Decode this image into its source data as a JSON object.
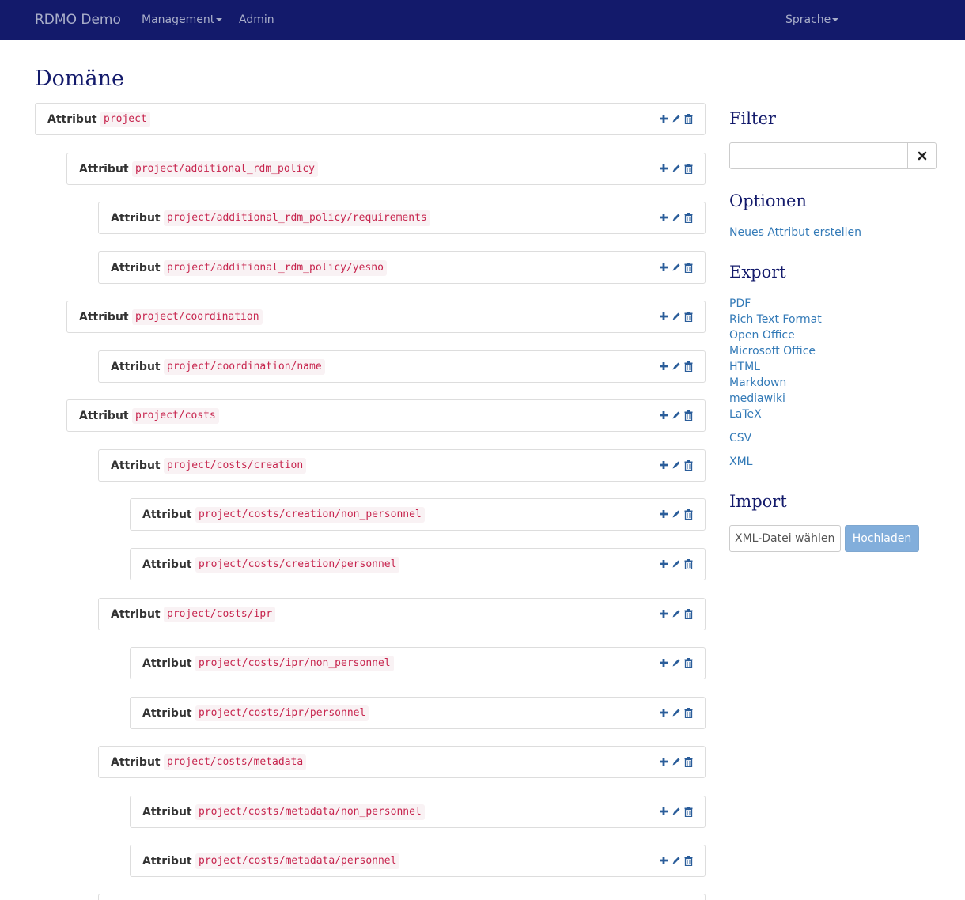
{
  "nav": {
    "brand": "RDMO Demo",
    "management": "Management",
    "admin": "Admin",
    "language": "Sprache"
  },
  "page_title": "Domäne",
  "row_label": "Attribut",
  "attributes": [
    "project",
    "project/additional_rdm_policy",
    "project/additional_rdm_policy/requirements",
    "project/additional_rdm_policy/yesno",
    "project/coordination",
    "project/coordination/name",
    "project/costs",
    "project/costs/creation",
    "project/costs/creation/non_personnel",
    "project/costs/creation/personnel",
    "project/costs/ipr",
    "project/costs/ipr/non_personnel",
    "project/costs/ipr/personnel",
    "project/costs/metadata",
    "project/costs/metadata/non_personnel",
    "project/costs/metadata/personnel"
  ],
  "sidebar": {
    "filter_heading": "Filter",
    "options_heading": "Optionen",
    "new_attribute": "Neues Attribut erstellen",
    "export_heading": "Export",
    "export_formats": [
      "PDF",
      "Rich Text Format",
      "Open Office",
      "Microsoft Office",
      "HTML",
      "Markdown",
      "mediawiki",
      "LaTeX"
    ],
    "export_csv": "CSV",
    "export_xml": "XML",
    "import_heading": "Import",
    "file_button": "XML-Datei wählen",
    "upload_button": "Hochladen"
  },
  "colors": {
    "navbar": "#131a6b",
    "link": "#337ab7",
    "code_text": "#c7254e",
    "icon": "#2a5d9a"
  },
  "icons": [
    "plus-icon",
    "pencil-icon",
    "trash-icon",
    "close-icon"
  ]
}
